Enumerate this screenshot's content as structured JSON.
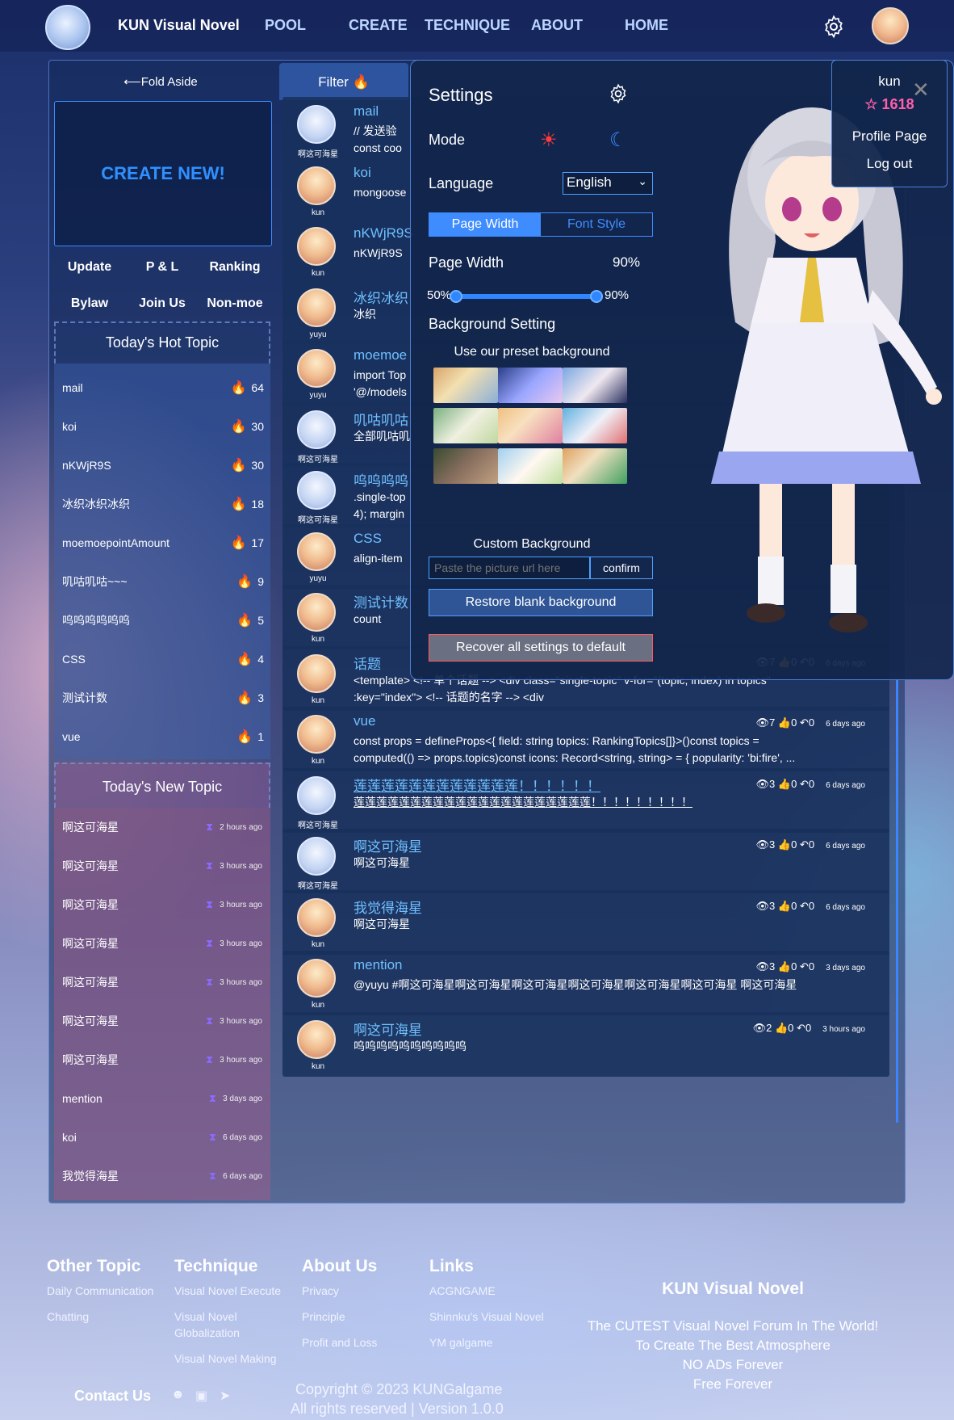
{
  "nav": {
    "brand": "KUN Visual Novel",
    "links": [
      "POOL",
      "CREATE",
      "TECHNIQUE",
      "ABOUT",
      "HOME"
    ]
  },
  "aside": {
    "fold": "⟵Fold Aside",
    "create": "CREATE NEW!",
    "quick": [
      "Update",
      "P & L",
      "Ranking",
      "Bylaw",
      "Join Us",
      "Non-moe"
    ],
    "hot_title": "Today's Hot Topic",
    "hot": [
      {
        "name": "mail",
        "count": "64"
      },
      {
        "name": "koi",
        "count": "30"
      },
      {
        "name": "nKWjR9S",
        "count": "30"
      },
      {
        "name": "冰织冰织冰织",
        "count": "18"
      },
      {
        "name": "moemoepointAmount",
        "count": "17"
      },
      {
        "name": "叽咕叽咕~~~",
        "count": "9"
      },
      {
        "name": "呜呜呜呜呜呜",
        "count": "5"
      },
      {
        "name": "CSS",
        "count": "4"
      },
      {
        "name": "测试计数",
        "count": "3"
      },
      {
        "name": "vue",
        "count": "1"
      }
    ],
    "new_title": "Today's New Topic",
    "new": [
      {
        "name": "啊这可海星",
        "ago": "2 hours ago"
      },
      {
        "name": "啊这可海星",
        "ago": "3 hours ago"
      },
      {
        "name": "啊这可海星",
        "ago": "3 hours ago"
      },
      {
        "name": "啊这可海星",
        "ago": "3 hours ago"
      },
      {
        "name": "啊这可海星",
        "ago": "3 hours ago"
      },
      {
        "name": "啊这可海星",
        "ago": "3 hours ago"
      },
      {
        "name": "啊这可海星",
        "ago": "3 hours ago"
      },
      {
        "name": "mention",
        "ago": "3 days ago"
      },
      {
        "name": "koi",
        "ago": "6 days ago"
      },
      {
        "name": "我觉得海星",
        "ago": "6 days ago"
      }
    ]
  },
  "feed": {
    "filter": "Filter",
    "topics": [
      {
        "user": "啊这可海星",
        "title": "mail",
        "body": "  // 发送验",
        "body2": "  const coo",
        "views": "",
        "likes": "",
        "replies": "",
        "ago": ""
      },
      {
        "user": "kun",
        "title": "koi",
        "body": "mongoose",
        "body2": "",
        "views": "",
        "likes": "",
        "replies": "",
        "ago": ""
      },
      {
        "user": "kun",
        "title": "nKWjR9S",
        "body": "nKWjR9S",
        "body2": "",
        "views": "",
        "likes": "",
        "replies": "",
        "ago": ""
      },
      {
        "user": "yuyu",
        "title": "冰织冰织",
        "body": "冰织",
        "body2": "",
        "views": "",
        "likes": "",
        "replies": "",
        "ago": ""
      },
      {
        "user": "yuyu",
        "title": "moemoe",
        "body": "import Top",
        "body2": "'@/models",
        "views": "",
        "likes": "",
        "replies": "",
        "ago": ""
      },
      {
        "user": "啊这可海星",
        "title": "叽咕叽咕",
        "body": "全部叽咕叽",
        "body2": "",
        "views": "",
        "likes": "",
        "replies": "",
        "ago": ""
      },
      {
        "user": "啊这可海星",
        "title": "呜呜呜呜",
        "body": ".single-top",
        "body2": "4);  margin",
        "views": "",
        "likes": "",
        "replies": "",
        "ago": ""
      },
      {
        "user": "yuyu",
        "title": "CSS",
        "body": "  align-item",
        "body2": "",
        "views": "",
        "likes": "",
        "replies": "",
        "ago": ""
      },
      {
        "user": "kun",
        "title": "测试计数",
        "body": "count",
        "body2": "",
        "views": "",
        "likes": "",
        "replies": "",
        "ago": ""
      },
      {
        "user": "kun",
        "title": "话题",
        "body": "<template>  <!-- 单个话题 -->  <div class=\"single-topic\" v-for=\"(topic, index) in topics\"",
        "body2": ":key=\"index\">    <!-- 话题的名字 -->    <div",
        "views": "7",
        "likes": "0",
        "replies": "0",
        "ago": "6 days ago"
      },
      {
        "user": "kun",
        "title": "vue",
        "body": "const props = defineProps<{  field: string  topics: RankingTopics[]}>()const topics =",
        "body2": "computed(() => props.topics)const icons: Record<string, string> = {  popularity: 'bi:fire', ...",
        "views": "7",
        "likes": "0",
        "replies": "0",
        "ago": "6 days ago"
      },
      {
        "user": "啊这可海星",
        "title": "莲莲莲莲莲莲莲莲莲莲莲莲！！！！！！",
        "body": "莲莲莲莲莲莲莲莲莲莲莲莲莲莲莲莲莲莲莲莲莲！！！！！！！！！",
        "body2": "",
        "views": "3",
        "likes": "0",
        "replies": "0",
        "ago": "6 days ago"
      },
      {
        "user": "啊这可海星",
        "title": "啊这可海星",
        "body": "啊这可海星",
        "body2": "",
        "views": "3",
        "likes": "0",
        "replies": "0",
        "ago": "6 days ago"
      },
      {
        "user": "kun",
        "title": "我觉得海星",
        "body": "啊这可海星",
        "body2": "",
        "views": "3",
        "likes": "0",
        "replies": "0",
        "ago": "6 days ago"
      },
      {
        "user": "kun",
        "title": "mention",
        "body": "@yuyu #啊这可海星啊这可海星啊这可海星啊这可海星啊这可海星啊这可海星 啊这可海星",
        "body2": "",
        "views": "3",
        "likes": "0",
        "replies": "0",
        "ago": "3 days ago"
      },
      {
        "user": "kun",
        "title": "啊这可海星",
        "body": "呜呜呜呜呜呜呜呜呜呜",
        "body2": "",
        "views": "2",
        "likes": "0",
        "replies": "0",
        "ago": "3 hours ago"
      }
    ]
  },
  "settings": {
    "title": "Settings",
    "mode": "Mode",
    "language": "Language",
    "language_value": "English",
    "tab_width": "Page Width",
    "tab_font": "Font Style",
    "page_width": "Page Width",
    "page_width_value": "90%",
    "slider_min": "50%",
    "slider_max": "90%",
    "slider_value": 1.0,
    "bg_title": "Background Setting",
    "preset": "Use our preset background",
    "custom": "Custom Background",
    "url_placeholder": "Paste the picture url here",
    "confirm": "confirm",
    "restore": "Restore blank background",
    "recover": "Recover all settings to default"
  },
  "user": {
    "name": "kun",
    "moemoe": "1618",
    "profile": "Profile Page",
    "logout": "Log out"
  },
  "footer": {
    "col1": {
      "title": "Other Topic",
      "items": [
        "Daily Communication",
        "Chatting"
      ]
    },
    "col2": {
      "title": "Technique",
      "items": [
        "Visual Novel Execute",
        "Visual Novel",
        "Globalization",
        "Visual Novel Making"
      ]
    },
    "col3": {
      "title": "About Us",
      "items": [
        "Privacy",
        "Principle",
        "Profit and Loss"
      ]
    },
    "col4": {
      "title": "Links",
      "items": [
        "ACGNGAME",
        "Shinnku's Visual Novel",
        "YM galgame"
      ]
    },
    "contact": "Contact Us",
    "copyright": "Copyright © 2023 KUNGalgame",
    "rights": "All rights reserved | Version 1.0.0",
    "brand": "KUN Visual Novel",
    "slogans": [
      "The CUTEST Visual Novel Forum In The World!",
      "To Create The Best Atmosphere",
      "NO ADs Forever",
      "Free Forever"
    ]
  }
}
